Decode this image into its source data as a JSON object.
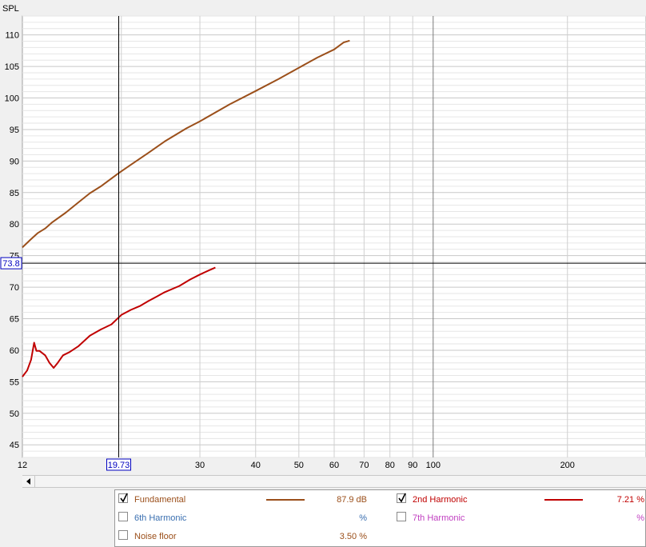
{
  "colors": {
    "fundamental": "#9b4f1a",
    "second_harmonic": "#c00000",
    "sixth_harmonic": "#3a6fb0",
    "seventh_harmonic": "#c03fc0",
    "grid": "#cfcfcf",
    "cursor": "#000000",
    "marker_box": "#0000c0"
  },
  "chart_data": {
    "type": "line",
    "ylabel": "SPL",
    "x_scale": "log",
    "xlim": [
      12,
      300
    ],
    "ylim": [
      43,
      113
    ],
    "y_ticks": [
      45,
      50,
      55,
      60,
      65,
      70,
      75,
      80,
      85,
      90,
      95,
      100,
      105,
      110
    ],
    "x_ticks": [
      12,
      30,
      40,
      50,
      60,
      70,
      80,
      90,
      100,
      200
    ],
    "cursor": {
      "x": 19.73,
      "x_label": "19.73",
      "y": 73.8,
      "y_label": "73.8"
    },
    "series": [
      {
        "name": "Fundamental",
        "color": "#9b4f1a",
        "points": [
          [
            12,
            76.3
          ],
          [
            12.5,
            77.5
          ],
          [
            13,
            78.6
          ],
          [
            13.5,
            79.3
          ],
          [
            14,
            80.3
          ],
          [
            15,
            81.8
          ],
          [
            16,
            83.4
          ],
          [
            17,
            84.9
          ],
          [
            18,
            86.0
          ],
          [
            19.73,
            88.1
          ],
          [
            21,
            89.4
          ],
          [
            23,
            91.3
          ],
          [
            25,
            93.1
          ],
          [
            28,
            95.2
          ],
          [
            30,
            96.3
          ],
          [
            35,
            99.0
          ],
          [
            40,
            101.1
          ],
          [
            45,
            103.0
          ],
          [
            50,
            104.8
          ],
          [
            55,
            106.4
          ],
          [
            60,
            107.7
          ],
          [
            63,
            108.8
          ],
          [
            65,
            109.1
          ]
        ]
      },
      {
        "name": "2nd Harmonic",
        "color": "#c00000",
        "points": [
          [
            12,
            55.8
          ],
          [
            12.3,
            56.8
          ],
          [
            12.55,
            58.5
          ],
          [
            12.75,
            61.2
          ],
          [
            12.9,
            59.9
          ],
          [
            13.1,
            59.9
          ],
          [
            13.5,
            59.2
          ],
          [
            13.8,
            58.0
          ],
          [
            14.1,
            57.2
          ],
          [
            14.4,
            58.0
          ],
          [
            14.8,
            59.2
          ],
          [
            15.3,
            59.7
          ],
          [
            16,
            60.6
          ],
          [
            17,
            62.3
          ],
          [
            18,
            63.3
          ],
          [
            19,
            64.1
          ],
          [
            20,
            65.6
          ],
          [
            21,
            66.4
          ],
          [
            22,
            67.0
          ],
          [
            23,
            67.8
          ],
          [
            24,
            68.5
          ],
          [
            25,
            69.2
          ],
          [
            27,
            70.2
          ],
          [
            28.5,
            71.2
          ],
          [
            30,
            72.0
          ],
          [
            31.5,
            72.7
          ],
          [
            32.5,
            73.1
          ]
        ]
      }
    ]
  },
  "legend": {
    "fundamental": {
      "label": "Fundamental",
      "checked": true,
      "value": "87.9 dB"
    },
    "second_harmonic": {
      "label": "2nd Harmonic",
      "checked": true,
      "value": "7.21 %"
    },
    "sixth_harmonic": {
      "label": "6th Harmonic",
      "checked": false,
      "value": "%"
    },
    "seventh_harmonic": {
      "label": "7th Harmonic",
      "checked": false,
      "value": "%"
    },
    "noise_floor": {
      "label": "Noise floor",
      "checked": false,
      "value": "3.50 %"
    }
  }
}
